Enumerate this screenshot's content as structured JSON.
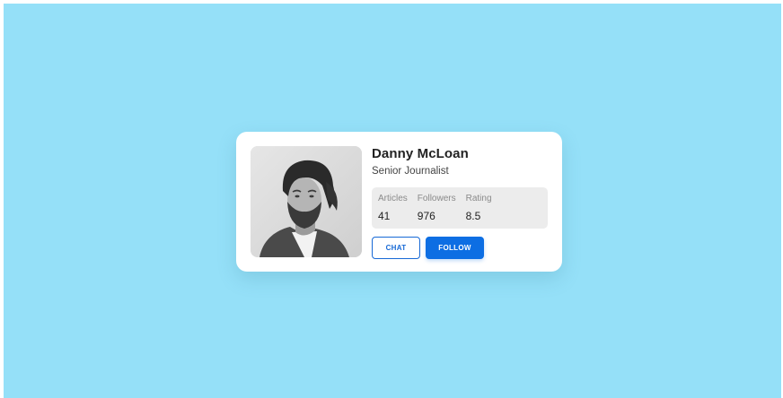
{
  "profile": {
    "name": "Danny McLoan",
    "title": "Senior Journalist",
    "photo_icon": "avatar-photo"
  },
  "stats": [
    {
      "label": "Articles",
      "value": "41"
    },
    {
      "label": "Followers",
      "value": "976"
    },
    {
      "label": "Rating",
      "value": "8.5"
    }
  ],
  "actions": {
    "chat_label": "CHAT",
    "follow_label": "FOLLOW"
  },
  "colors": {
    "background": "#95e0f8",
    "card": "#ffffff",
    "accent": "#0d6ee3",
    "stats_panel": "#ececec"
  }
}
